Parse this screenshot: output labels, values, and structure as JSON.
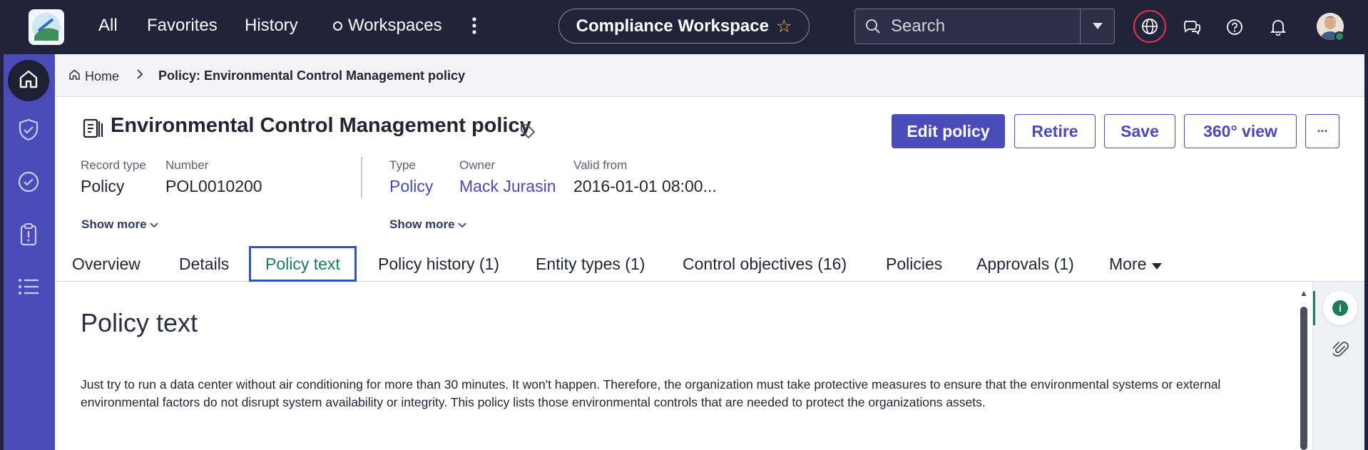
{
  "topbar": {
    "nav": [
      "All",
      "Favorites",
      "History",
      "Workspaces"
    ],
    "workspace_title": "Compliance Workspace",
    "search_placeholder": "Search",
    "icons": [
      "globe-icon",
      "chat-icon",
      "help-icon",
      "bell-icon"
    ],
    "colors": {
      "bar": "#20233a",
      "globe_ring": "#e8334a",
      "star": "#e8c347"
    }
  },
  "breadcrumb": {
    "home": "Home",
    "current": "Policy: Environmental Control Management policy"
  },
  "record": {
    "title": "Environmental Control Management policy",
    "buttons": {
      "edit": "Edit policy",
      "retire": "Retire",
      "save": "Save",
      "view360": "360° view",
      "more": "···"
    },
    "fields": {
      "record_type_label": "Record type",
      "record_type_value": "Policy",
      "number_label": "Number",
      "number_value": "POL0010200",
      "type_label": "Type",
      "type_value": "Policy",
      "owner_label": "Owner",
      "owner_value": "Mack Jurasin",
      "valid_from_label": "Valid from",
      "valid_from_value": "2016-01-01 08:00..."
    },
    "show_more": "Show more"
  },
  "tabs": {
    "items": [
      "Overview",
      "Details",
      "Policy text",
      "Policy history (1)",
      "Entity types (1)",
      "Control objectives (16)",
      "Policies",
      "Approvals (1)",
      "More"
    ],
    "active": "Policy text"
  },
  "content": {
    "section_title": "Policy text",
    "body": "Just try to run a data center without air conditioning for more than 30 minutes. It won't happen. Therefore, the organization must take protective measures to ensure that the environmental systems or external environmental factors do not disrupt system availability or integrity. This policy lists those environmental controls that are needed to protect the organizations assets."
  },
  "right_panel": {
    "icons": [
      "info-icon",
      "paperclip-icon"
    ],
    "info_glyph": "i"
  },
  "colors": {
    "accent": "#4a4bb8",
    "active_tab_text": "#1e7a5a",
    "active_tab_border": "#2b56c9"
  }
}
